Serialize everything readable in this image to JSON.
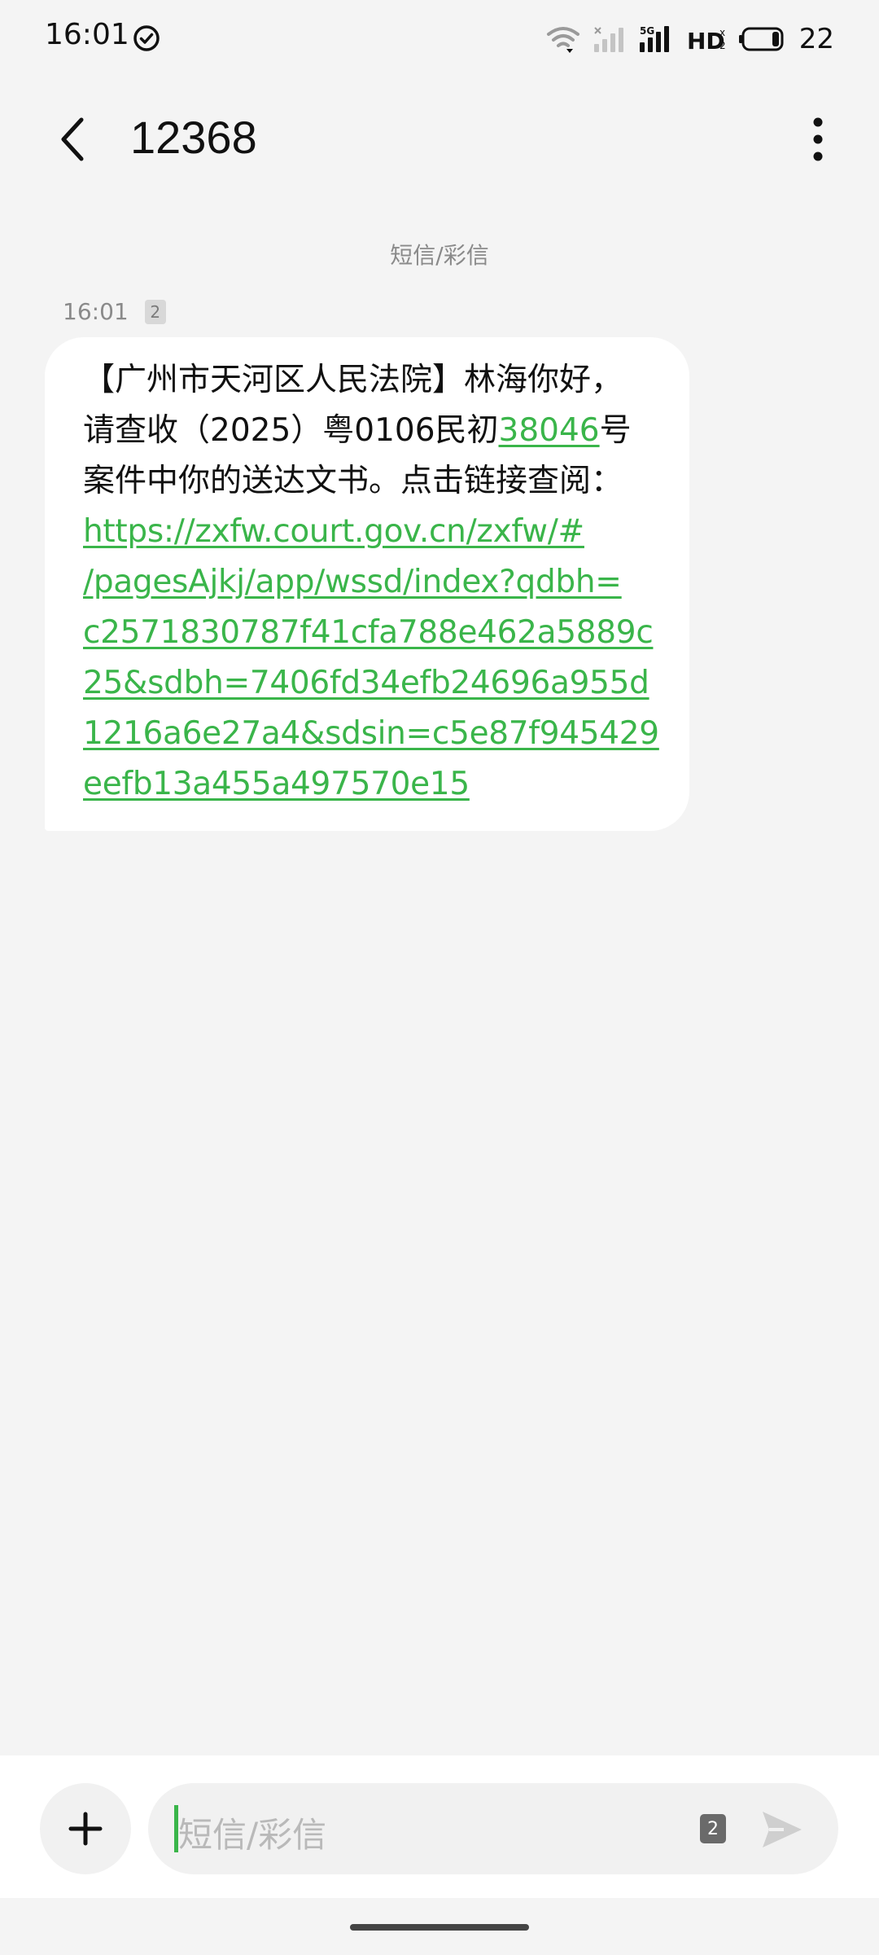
{
  "status_bar": {
    "time": "16:01",
    "battery": "22",
    "icons": [
      "check-circle-icon",
      "wifi-icon",
      "signal-icon",
      "signal-5g-icon",
      "hd-icon",
      "battery-icon"
    ]
  },
  "header": {
    "title": "12368",
    "icons": [
      "back-arrow-icon",
      "more-vertical-icon"
    ]
  },
  "conversation": {
    "channel_label": "短信/彩信",
    "message": {
      "time": "16:01",
      "sim": "2",
      "lines": [
        "【广州市天河区人民法院】林海你好，",
        "请查收（2025）粤0106民初",
        "号",
        "案件中你的送达文书。点击链接查阅："
      ],
      "case_number_link": "38046",
      "url_lines": [
        "https://zxfw.court.gov.cn/zxfw/#",
        "/pagesAjkj/app/wssd/index?qdbh=",
        "c2571830787f41cfa788e462a5889c",
        "25&sdbh=7406fd34efb24696a955d",
        "1216a6e27a4&sdsin=c5e87f945429",
        "eefb13a455a497570e15"
      ]
    }
  },
  "composer": {
    "placeholder": "短信/彩信",
    "sim": "2",
    "icons": [
      "plus-icon",
      "send-icon"
    ]
  },
  "colors": {
    "link": "#3ab54a",
    "background": "#f4f4f4",
    "bubble": "#ffffff"
  }
}
